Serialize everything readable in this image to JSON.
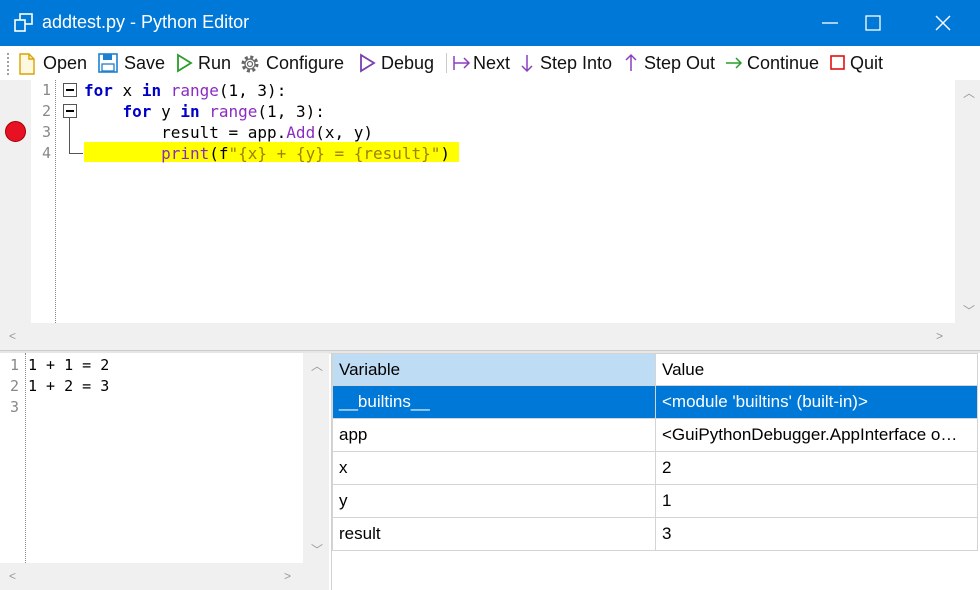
{
  "window": {
    "title": "addtest.py - Python Editor"
  },
  "toolbar": {
    "open": "Open",
    "save": "Save",
    "run": "Run",
    "configure": "Configure",
    "debug": "Debug",
    "next": "Next",
    "step_into": "Step Into",
    "step_out": "Step Out",
    "continue": "Continue",
    "quit": "Quit"
  },
  "editor": {
    "line_numbers": [
      "1",
      "2",
      "3",
      "4"
    ],
    "breakpoint_line": 3,
    "current_line": 4
  },
  "output": {
    "line_numbers": [
      "1",
      "2",
      "3"
    ],
    "lines": [
      "1 + 1 = 2",
      "1 + 2 = 3",
      ""
    ]
  },
  "variables": {
    "headers": [
      "Variable",
      "Value"
    ],
    "rows": [
      {
        "name": "__builtins__",
        "value": "<module 'builtins' (built-in)>"
      },
      {
        "name": "app",
        "value": "<GuiPythonDebugger.AppInterface o…"
      },
      {
        "name": "x",
        "value": "2"
      },
      {
        "name": "y",
        "value": "1"
      },
      {
        "name": "result",
        "value": "3"
      }
    ]
  },
  "colors": {
    "titlebar": "#0078d7",
    "selection": "#0078d7",
    "current_line": "#ffff00",
    "breakpoint": "#e81123"
  }
}
